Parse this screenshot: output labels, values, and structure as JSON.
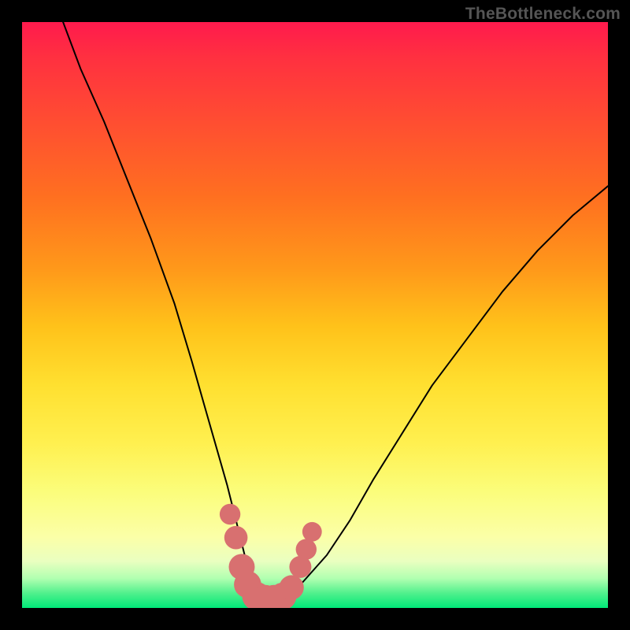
{
  "watermark": "TheBottleneck.com",
  "colors": {
    "gradient_top": "#ff1a4d",
    "gradient_mid": "#fff050",
    "gradient_bottom": "#00e878",
    "curve_stroke": "#000000",
    "marker_fill": "#d87070",
    "frame_bg": "#000000"
  },
  "chart_data": {
    "type": "line",
    "title": "",
    "xlabel": "",
    "ylabel": "",
    "xlim": [
      0,
      100
    ],
    "ylim": [
      0,
      100
    ],
    "grid": false,
    "legend": false,
    "series": [
      {
        "name": "bottleneck-curve",
        "x": [
          7,
          10,
          14,
          18,
          22,
          26,
          29,
          31,
          33,
          35,
          36.5,
          38,
          39.5,
          41,
          42.5,
          44,
          46,
          48,
          52,
          56,
          60,
          65,
          70,
          76,
          82,
          88,
          94,
          100
        ],
        "y": [
          100,
          92,
          83,
          73,
          63,
          52,
          42,
          35,
          28,
          21,
          15,
          9,
          5,
          2.5,
          1.5,
          1.5,
          2.5,
          4.5,
          9,
          15,
          22,
          30,
          38,
          46,
          54,
          61,
          67,
          72
        ]
      }
    ],
    "markers": {
      "name": "emphasis-dots",
      "points": [
        {
          "x": 35.5,
          "y": 16,
          "r": 1.0
        },
        {
          "x": 36.5,
          "y": 12,
          "r": 1.2
        },
        {
          "x": 37.5,
          "y": 7,
          "r": 1.4
        },
        {
          "x": 38.5,
          "y": 4,
          "r": 1.5
        },
        {
          "x": 40.0,
          "y": 2,
          "r": 1.6
        },
        {
          "x": 41.5,
          "y": 1.5,
          "r": 1.6
        },
        {
          "x": 43.0,
          "y": 1.5,
          "r": 1.6
        },
        {
          "x": 44.5,
          "y": 2,
          "r": 1.5
        },
        {
          "x": 46.0,
          "y": 3.5,
          "r": 1.3
        },
        {
          "x": 47.5,
          "y": 7,
          "r": 1.1
        },
        {
          "x": 48.5,
          "y": 10,
          "r": 1.0
        },
        {
          "x": 49.5,
          "y": 13,
          "r": 0.9
        }
      ]
    }
  }
}
